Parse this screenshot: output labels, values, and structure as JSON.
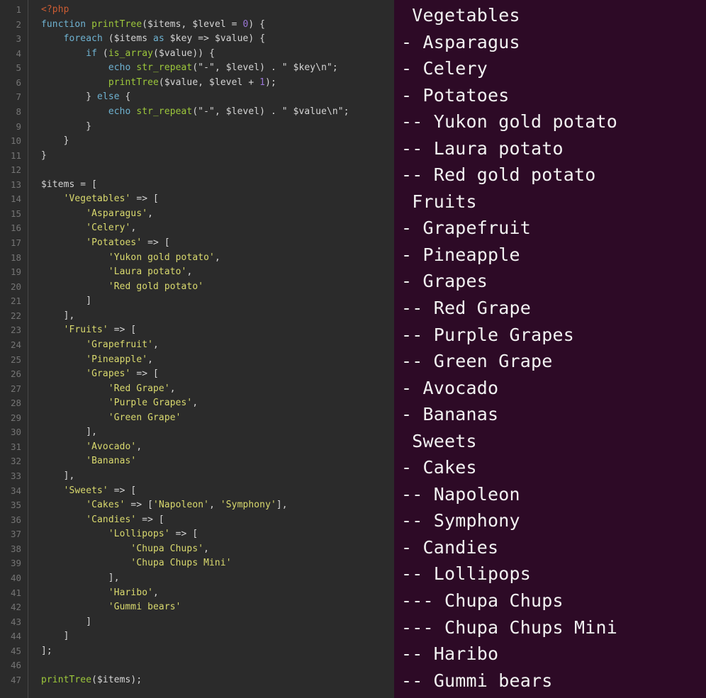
{
  "editor": {
    "language": "php",
    "background": "#2b2b2b",
    "line_number_color": "#757575",
    "first_line_number": 1,
    "last_line_number": 47,
    "line_numbers": [
      1,
      2,
      3,
      4,
      5,
      6,
      7,
      8,
      9,
      10,
      11,
      12,
      13,
      14,
      15,
      16,
      17,
      18,
      19,
      20,
      21,
      22,
      23,
      24,
      25,
      26,
      27,
      28,
      29,
      30,
      31,
      32,
      33,
      34,
      35,
      36,
      37,
      38,
      39,
      40,
      41,
      42,
      43,
      44,
      45,
      46,
      47
    ],
    "lines": [
      "<?php",
      "function printTree($items, $level = 0) {",
      "    foreach ($items as $key => $value) {",
      "        if (is_array($value)) {",
      "            echo str_repeat(\"-\", $level) . \" $key\\n\";",
      "            printTree($value, $level + 1);",
      "        } else {",
      "            echo str_repeat(\"-\", $level) . \" $value\\n\";",
      "        }",
      "    }",
      "}",
      "",
      "$items = [",
      "    'Vegetables' => [",
      "        'Asparagus',",
      "        'Celery',",
      "        'Potatoes' => [",
      "            'Yukon gold potato',",
      "            'Laura potato',",
      "            'Red gold potato'",
      "        ]",
      "    ],",
      "    'Fruits' => [",
      "        'Grapefruit',",
      "        'Pineapple',",
      "        'Grapes' => [",
      "            'Red Grape',",
      "            'Purple Grapes',",
      "            'Green Grape'",
      "        ],",
      "        'Avocado',",
      "        'Bananas'",
      "    ],",
      "    'Sweets' => [",
      "        'Cakes' => ['Napoleon', 'Symphony'],",
      "        'Candies' => [",
      "            'Lollipops' => [",
      "                'Chupa Chups',",
      "                'Chupa Chups Mini'",
      "            ],",
      "            'Haribo',",
      "            'Gummi bears'",
      "        ]",
      "    ]",
      "];",
      "",
      "printTree($items);"
    ],
    "syntax_colors": {
      "tag": "#cc5c33",
      "keyword": "#6fb3d2",
      "function": "#9ec93b",
      "string": "#dada6e",
      "number": "#9a76d6",
      "plain": "#d6d6d6"
    }
  },
  "terminal": {
    "background": "#2d0a26",
    "text_color": "#f2f2f2",
    "lines": [
      " Vegetables",
      "- Asparagus",
      "- Celery",
      "- Potatoes",
      "-- Yukon gold potato",
      "-- Laura potato",
      "-- Red gold potato",
      " Fruits",
      "- Grapefruit",
      "- Pineapple",
      "- Grapes",
      "-- Red Grape",
      "-- Purple Grapes",
      "-- Green Grape",
      "- Avocado",
      "- Bananas",
      " Sweets",
      "- Cakes",
      "-- Napoleon",
      "-- Symphony",
      "- Candies",
      "-- Lollipops",
      "--- Chupa Chups",
      "--- Chupa Chups Mini",
      "-- Haribo",
      "-- Gummi bears"
    ]
  }
}
